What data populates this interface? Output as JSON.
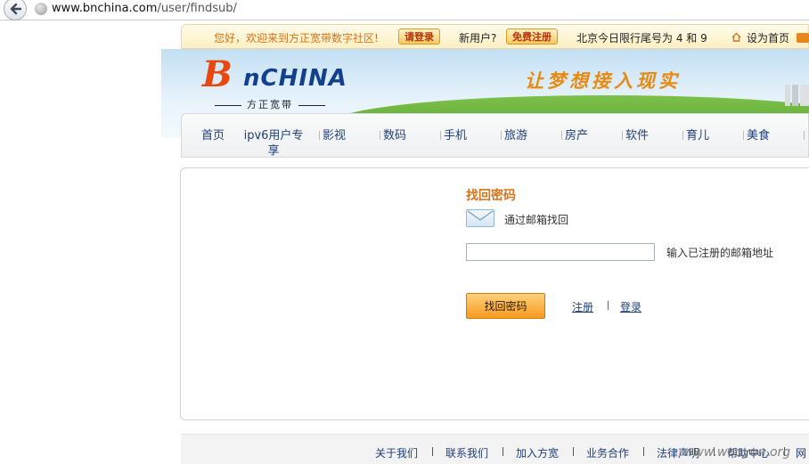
{
  "browser": {
    "url_domain": "www.bnchina.com",
    "url_path": "/user/findsub/"
  },
  "topbar": {
    "welcome": "您好，欢迎来到方正宽带数字社区!",
    "login_button": "请登录",
    "new_user": "新用户?",
    "register_button": "免费注册",
    "traffic_limit": "北京今日限行尾号为 4 和 9",
    "set_homepage": "设为首页"
  },
  "banner": {
    "logo_b": "B",
    "logo_rest": "nCHINA",
    "logo_subtitle": "方正宽带",
    "slogan": "让梦想接入现实"
  },
  "nav": {
    "items": [
      "首页",
      "ipv6用户专享",
      "影视",
      "数码",
      "手机",
      "旅游",
      "房产",
      "软件",
      "育儿",
      "美食"
    ]
  },
  "form": {
    "title": "找回密码",
    "method_label": "通过邮箱找回",
    "email_value": "",
    "email_hint": "输入已注册的邮箱地址",
    "submit_label": "找回密码",
    "register_link": "注册",
    "login_link": "登录"
  },
  "footer": {
    "links": [
      "关于我们",
      "联系我们",
      "加入方宽",
      "业务合作",
      "法律声明",
      "帮助中心",
      "网"
    ]
  },
  "watermark": "www.wooyun.org"
}
